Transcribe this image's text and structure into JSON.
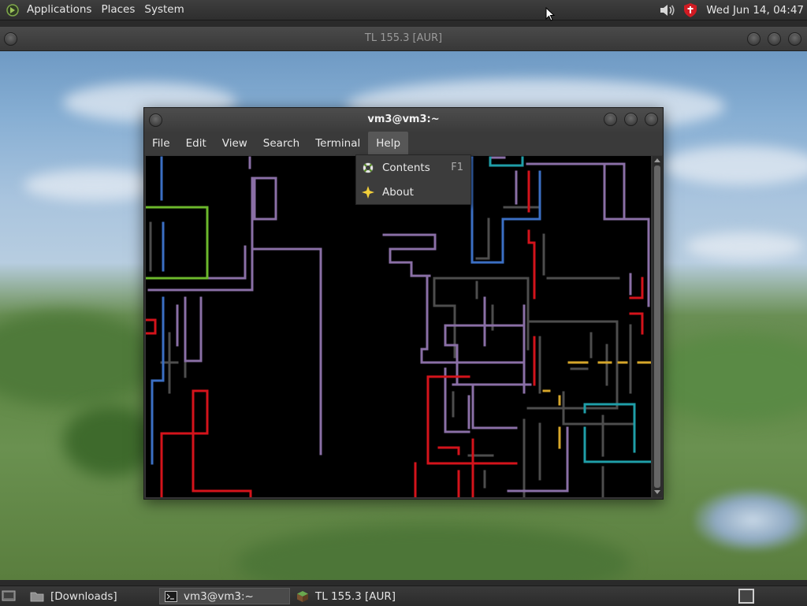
{
  "top_panel": {
    "menus": [
      "Applications",
      "Places",
      "System"
    ],
    "clock": "Wed Jun 14, 04:47",
    "tray_icons": [
      "volume-icon",
      "security-shield-icon"
    ]
  },
  "background_window": {
    "title": "TL 155.3 [AUR]"
  },
  "terminal": {
    "title": "vm3@vm3:~",
    "menus": [
      "File",
      "Edit",
      "View",
      "Search",
      "Terminal",
      "Help"
    ],
    "active_menu": "Help"
  },
  "help_menu": {
    "items": [
      {
        "label": "Contents",
        "accelerator": "F1",
        "icon": "help-lifebuoy-icon"
      },
      {
        "label": "About",
        "accelerator": "",
        "icon": "about-star-icon"
      }
    ]
  },
  "taskbar": {
    "tasks": [
      {
        "label": "[Downloads]",
        "icon": "folder-icon",
        "active": false
      },
      {
        "label": "vm3@vm3:~",
        "icon": "terminal-icon",
        "active": true
      },
      {
        "label": "TL 155.3 [AUR]",
        "icon": "minecraft-block-icon",
        "active": false
      }
    ]
  },
  "colors": {
    "pipe_red": "#d4131b",
    "pipe_green": "#6cb82c",
    "pipe_blue": "#3b6fc4",
    "pipe_purple": "#8a6fa6",
    "pipe_gray": "#4d4d4d",
    "pipe_cyan": "#1f9ea8",
    "pipe_yellow": "#d6a62a"
  }
}
